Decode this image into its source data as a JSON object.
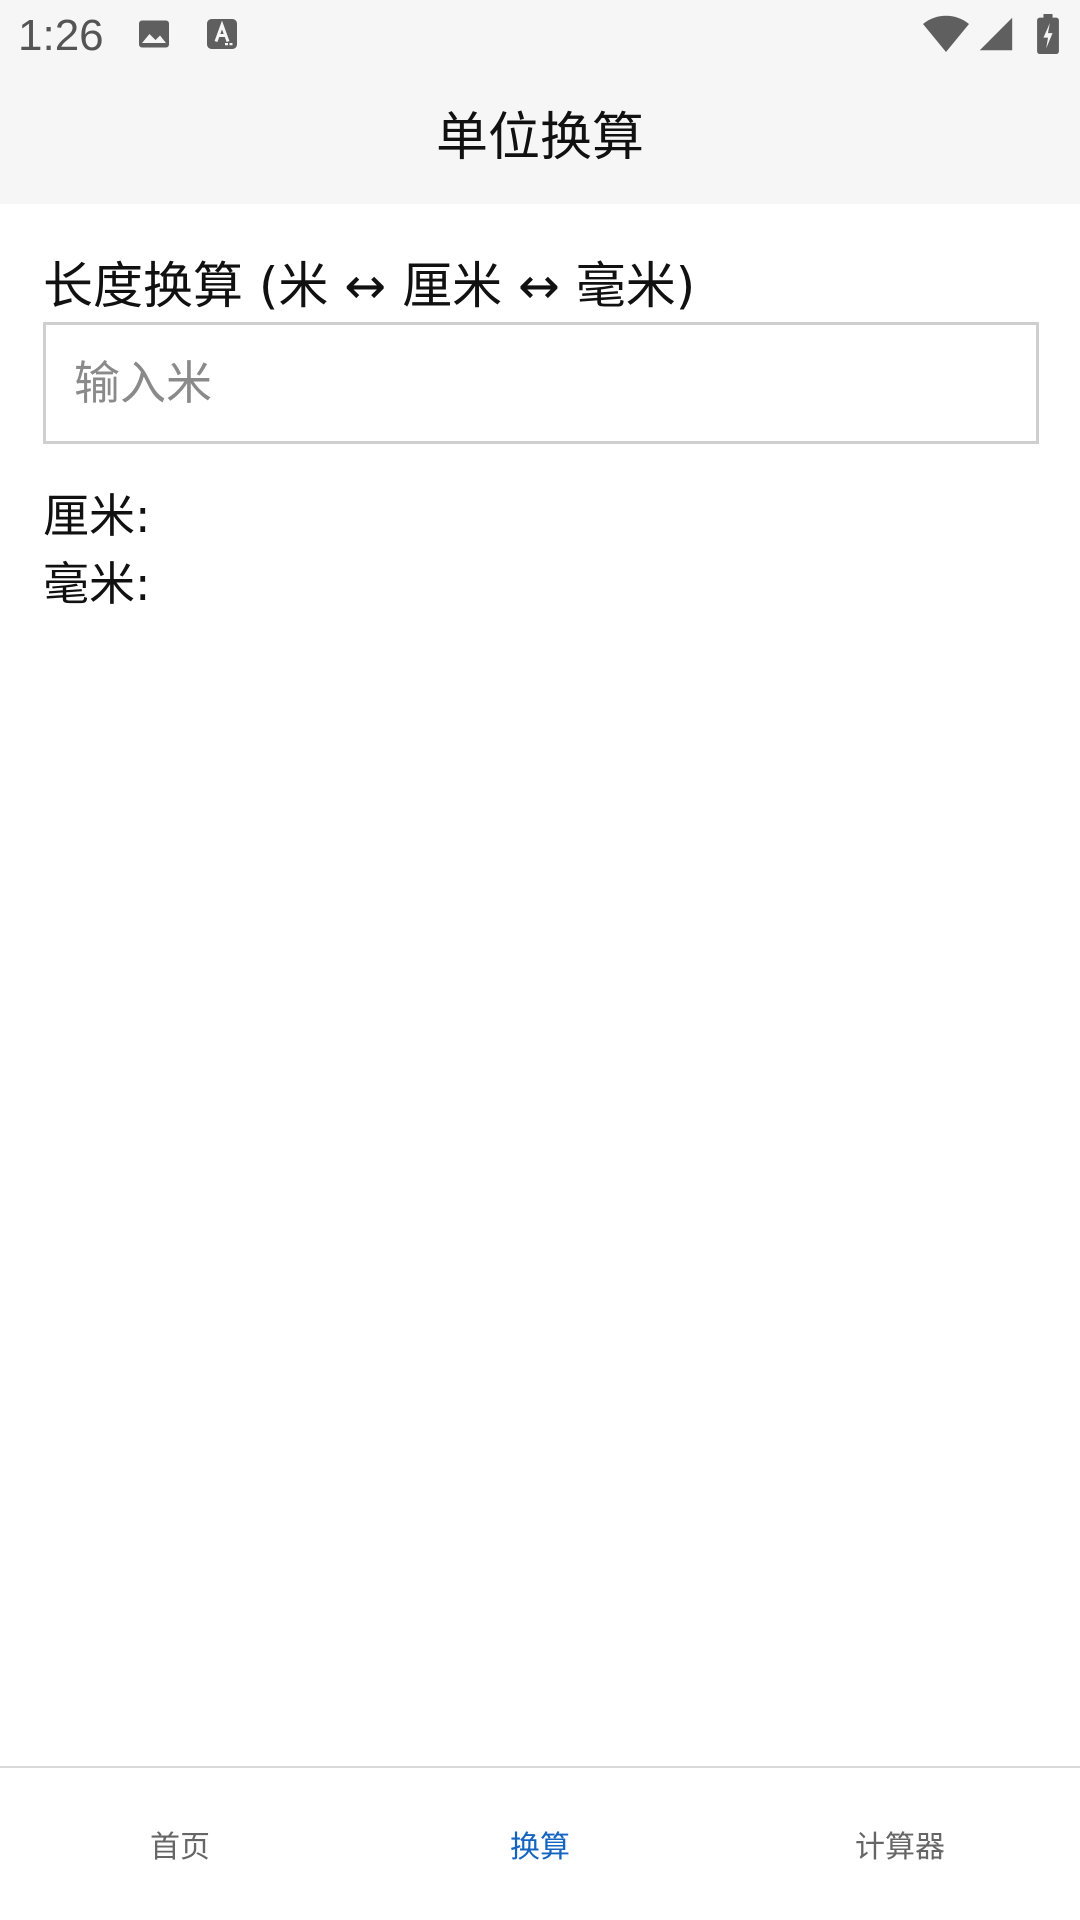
{
  "status_bar": {
    "time": "1:26",
    "icons_left": [
      "image-icon",
      "keyboard-a-icon"
    ],
    "icons_right": [
      "wifi-icon",
      "cell-signal-icon",
      "battery-charging-icon"
    ]
  },
  "app_bar": {
    "title": "单位换算"
  },
  "length_converter": {
    "title": "长度换算 (米 ↔ 厘米 ↔ 毫米)",
    "input": {
      "value": "",
      "placeholder": "输入米"
    },
    "results": {
      "cm_label": "厘米:",
      "cm_value": "",
      "mm_label": "毫米:",
      "mm_value": ""
    }
  },
  "bottom_nav": {
    "items": [
      {
        "label": "首页",
        "active": false
      },
      {
        "label": "换算",
        "active": true
      },
      {
        "label": "计算器",
        "active": false
      }
    ],
    "active_color": "#1565c0",
    "inactive_color": "#666666"
  }
}
